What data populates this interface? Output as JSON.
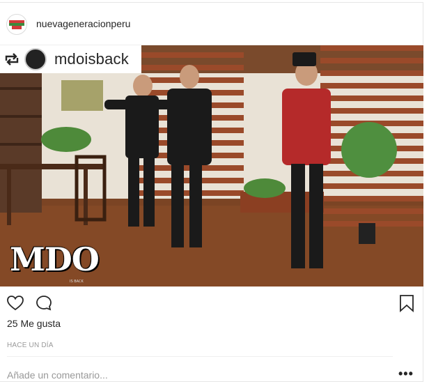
{
  "header": {
    "username": "nuevageneracionperu",
    "avatar_text": "Nueva Generación Perú"
  },
  "photo": {
    "regram_username": "mdoisback",
    "logo_text": "MDO",
    "logo_subtext": "IS BACK"
  },
  "engagement": {
    "likes_label": "25 Me gusta",
    "timestamp": "HACE UN DÍA"
  },
  "comment": {
    "placeholder": "Añade un comentario...",
    "more_label": "•••"
  },
  "colors": {
    "text": "#262626",
    "muted": "#999999",
    "border": "#efefef"
  },
  "icons": [
    "heart-icon",
    "comment-icon",
    "bookmark-icon",
    "regram-icon"
  ]
}
